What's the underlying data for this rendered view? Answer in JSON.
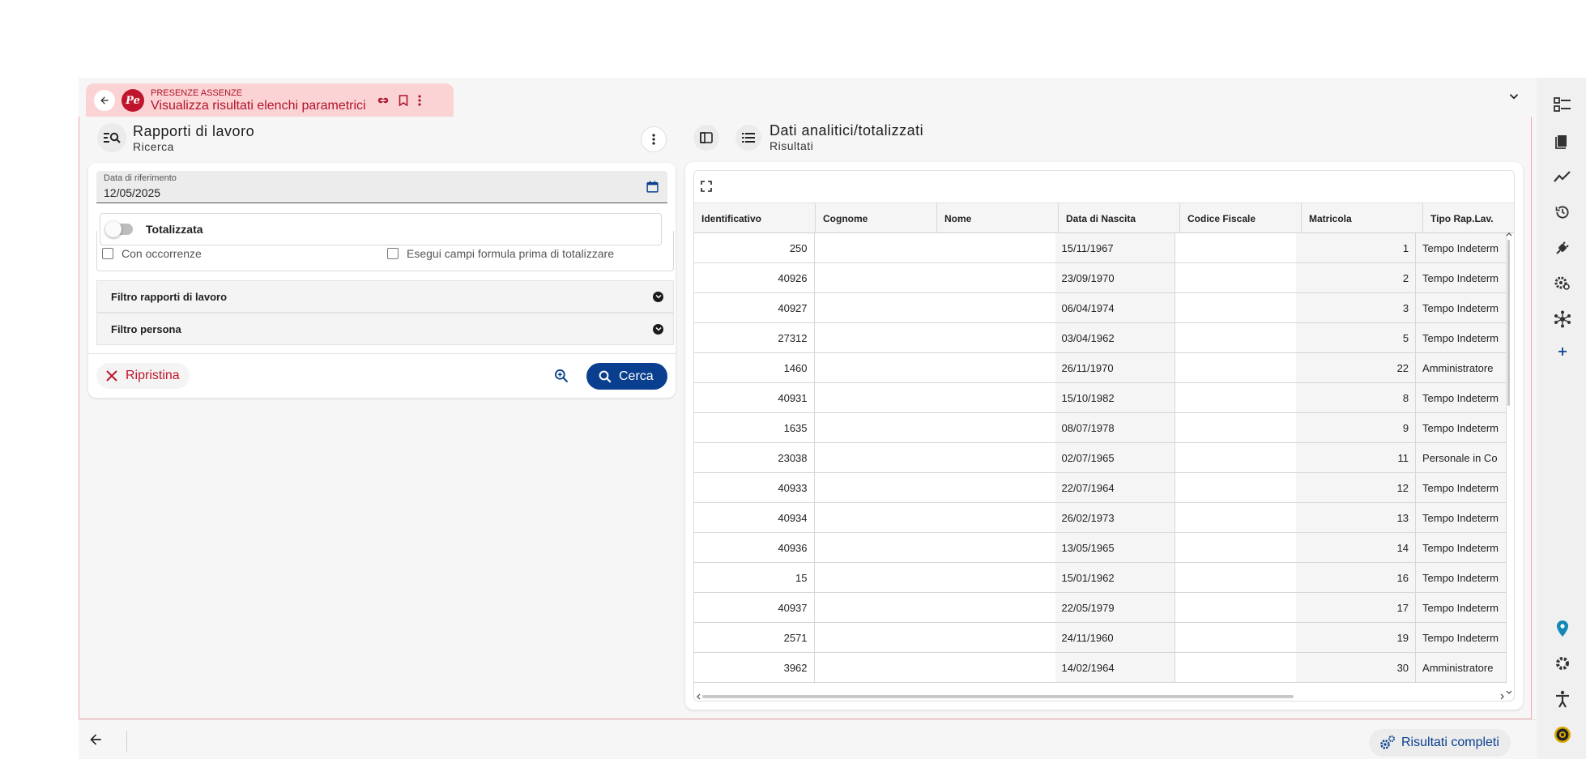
{
  "workspace_tab": {
    "app_name": "PRESENZE ASSENZE",
    "title": "Visualizza risultati elenchi parametrici",
    "logo_text": "Pe"
  },
  "left_panel": {
    "title": "Rapporti di lavoro",
    "subtitle": "Ricerca",
    "date_label": "Data di riferimento",
    "date_value": "12/05/2025",
    "toggle_label": "Totalizzata",
    "checkbox_1": "Con occorrenze",
    "checkbox_2": "Esegui campi formula prima di totalizzare",
    "accordion_1": "Filtro rapporti di lavoro",
    "accordion_2": "Filtro persona",
    "reset_label": "Ripristina",
    "search_label": "Cerca"
  },
  "right_panel": {
    "title": "Dati analitici/totalizzati",
    "subtitle": "Risultati"
  },
  "table": {
    "columns": [
      "Identificativo",
      "Cognome",
      "Nome",
      "Data di Nascita",
      "Codice Fiscale",
      "Matricola",
      "Tipo Rap.Lav."
    ],
    "rows": [
      {
        "id": "250",
        "dob": "15/11/1967",
        "mat": "1",
        "tipo": "Tempo Indeterm"
      },
      {
        "id": "40926",
        "dob": "23/09/1970",
        "mat": "2",
        "tipo": "Tempo Indeterm"
      },
      {
        "id": "40927",
        "dob": "06/04/1974",
        "mat": "3",
        "tipo": "Tempo Indeterm"
      },
      {
        "id": "27312",
        "dob": "03/04/1962",
        "mat": "5",
        "tipo": "Tempo Indeterm"
      },
      {
        "id": "1460",
        "dob": "26/11/1970",
        "mat": "22",
        "tipo": "Amministratore"
      },
      {
        "id": "40931",
        "dob": "15/10/1982",
        "mat": "8",
        "tipo": "Tempo Indeterm"
      },
      {
        "id": "1635",
        "dob": "08/07/1978",
        "mat": "9",
        "tipo": "Tempo Indeterm"
      },
      {
        "id": "23038",
        "dob": "02/07/1965",
        "mat": "11",
        "tipo": "Personale in Co"
      },
      {
        "id": "40933",
        "dob": "22/07/1964",
        "mat": "12",
        "tipo": "Tempo Indeterm"
      },
      {
        "id": "40934",
        "dob": "26/02/1973",
        "mat": "13",
        "tipo": "Tempo Indeterm"
      },
      {
        "id": "40936",
        "dob": "13/05/1965",
        "mat": "14",
        "tipo": "Tempo Indeterm"
      },
      {
        "id": "15",
        "dob": "15/01/1962",
        "mat": "16",
        "tipo": "Tempo Indeterm"
      },
      {
        "id": "40937",
        "dob": "22/05/1979",
        "mat": "17",
        "tipo": "Tempo Indeterm"
      },
      {
        "id": "2571",
        "dob": "24/11/1960",
        "mat": "19",
        "tipo": "Tempo Indeterm"
      },
      {
        "id": "3962",
        "dob": "14/02/1964",
        "mat": "30",
        "tipo": "Amministratore"
      }
    ]
  },
  "footer": {
    "full_results_label": "Risultati completi"
  },
  "colors": {
    "brand_red": "#c0162d",
    "tab_pink": "#fbd3d5",
    "primary_blue": "#0a3f8f"
  }
}
